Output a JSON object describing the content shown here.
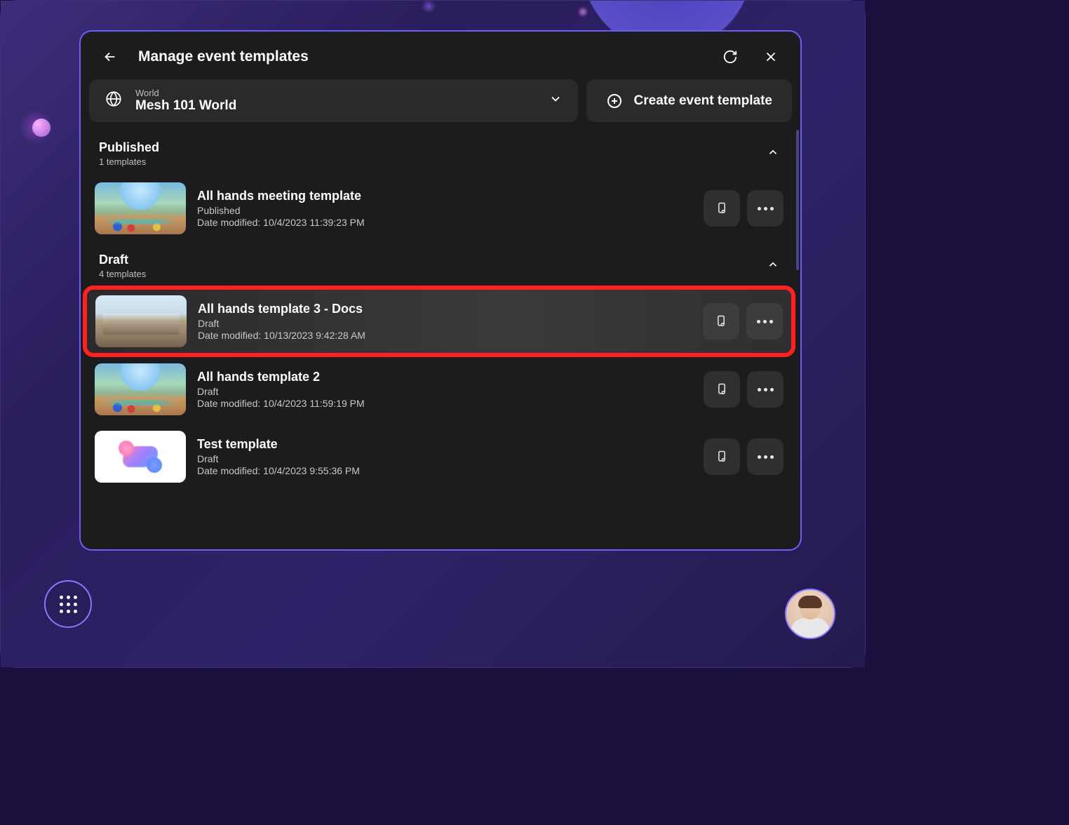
{
  "header": {
    "title": "Manage event templates"
  },
  "world_selector": {
    "label": "World",
    "value": "Mesh 101 World"
  },
  "create_button": "Create event template",
  "date_prefix": "Date modified: ",
  "sections": [
    {
      "title": "Published",
      "subtitle": "1 templates",
      "items": [
        {
          "title": "All hands meeting template",
          "status": "Published",
          "date": "10/4/2023 11:39:23 PM",
          "thumb": "env1",
          "highlighted": false
        }
      ]
    },
    {
      "title": "Draft",
      "subtitle": "4 templates",
      "items": [
        {
          "title": "All hands template 3 - Docs",
          "status": "Draft",
          "date": "10/13/2023 9:42:28 AM",
          "thumb": "env2",
          "highlighted": true
        },
        {
          "title": "All hands template 2",
          "status": "Draft",
          "date": "10/4/2023 11:59:19 PM",
          "thumb": "env1",
          "highlighted": false
        },
        {
          "title": "Test template",
          "status": "Draft",
          "date": "10/4/2023 9:55:36 PM",
          "thumb": "logo",
          "highlighted": false
        }
      ]
    }
  ]
}
